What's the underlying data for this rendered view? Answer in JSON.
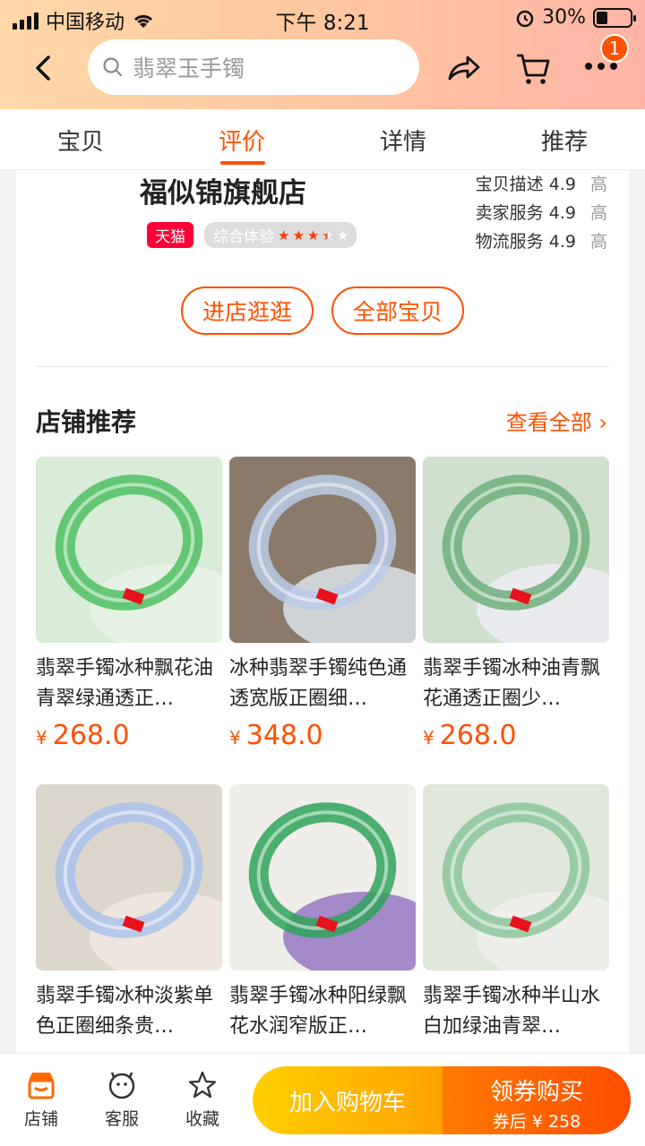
{
  "status_bar": {
    "carrier": "中国移动",
    "time": "下午 8:21",
    "battery": "30%"
  },
  "header": {
    "search_placeholder": "翡翠玉手镯",
    "menu_badge": "1"
  },
  "tabs": [
    {
      "label": "宝贝",
      "active": false
    },
    {
      "label": "评价",
      "active": true
    },
    {
      "label": "详情",
      "active": false
    },
    {
      "label": "推荐",
      "active": false
    }
  ],
  "shop": {
    "name": "福似锦旗舰店",
    "tmall_tag": "天猫",
    "experience_label": "综合体验",
    "experience_rating": 3.5,
    "scores": [
      {
        "label": "宝贝描述",
        "value": "4.9",
        "level": "高"
      },
      {
        "label": "卖家服务",
        "value": "4.9",
        "level": "高"
      },
      {
        "label": "物流服务",
        "value": "4.9",
        "level": "高"
      }
    ],
    "visit_button": "进店逛逛",
    "all_items_button": "全部宝贝"
  },
  "recommend": {
    "title": "店铺推荐",
    "see_all": "查看全部",
    "currency": "¥",
    "products": [
      {
        "title": "翡翠手镯冰种飘花油青翠绿通透正…",
        "price": "268.0",
        "colors": [
          "#d8ecd8",
          "#4fbf63",
          "#e8f3e6"
        ]
      },
      {
        "title": "冰种翡翠手镯纯色通透宽版正圈细…",
        "price": "348.0",
        "colors": [
          "#8b7a6a",
          "#b9cbe8",
          "#d7dde2"
        ]
      },
      {
        "title": "翡翠手镯冰种油青飘花通透正圈少…",
        "price": "268.0",
        "colors": [
          "#cfe0cc",
          "#6fae7a",
          "#ececf2"
        ]
      },
      {
        "title": "翡翠手镯冰种淡紫单色正圈细条贵…",
        "price": "",
        "colors": [
          "#ddd6cc",
          "#a9c2ea",
          "#efe8e0"
        ]
      },
      {
        "title": "翡翠手镯冰种阳绿飘花水润窄版正…",
        "price": "",
        "colors": [
          "#f0eee8",
          "#2fa259",
          "#9b7ec6"
        ]
      },
      {
        "title": "翡翠手镯冰种半山水白加绿油青翠…",
        "price": "",
        "colors": [
          "#dfe8da",
          "#8cc69a",
          "#f0f0ec"
        ]
      }
    ]
  },
  "bottom_bar": {
    "shop_label": "店铺",
    "service_label": "客服",
    "favorite_label": "收藏",
    "add_to_cart": "加入购物车",
    "buy_label": "领券购买",
    "buy_sub": "券后 ¥ 258"
  }
}
